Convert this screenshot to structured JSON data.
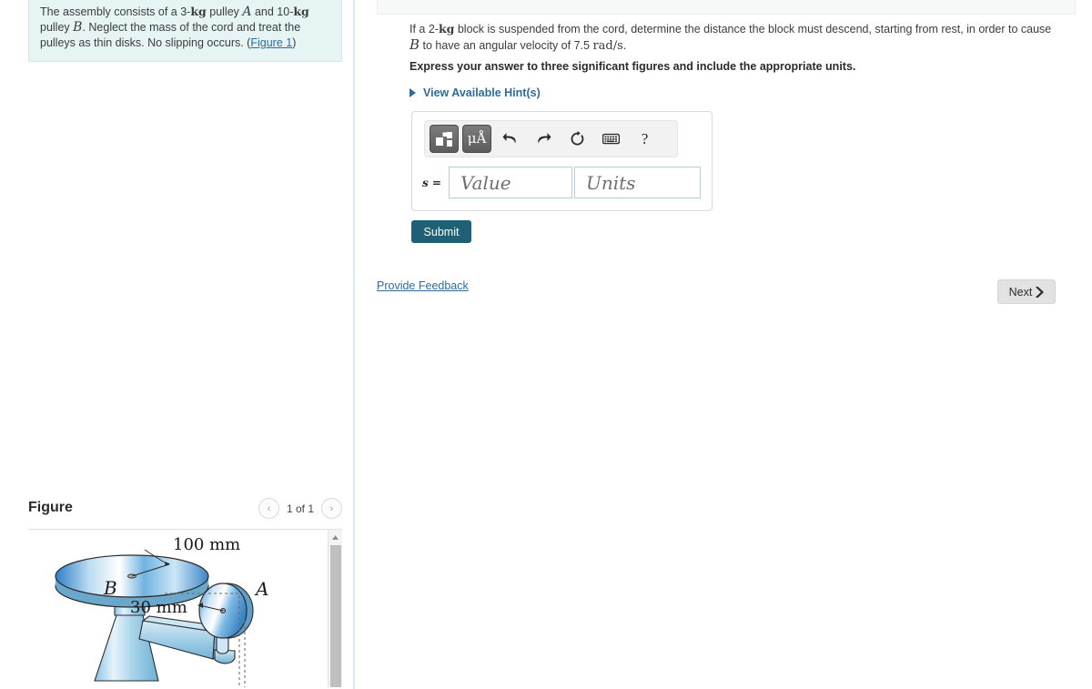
{
  "problem": {
    "text_part1": "The assembly consists of a 3-",
    "unit_kg_1": "kg",
    "text_part2": " pulley ",
    "pulley_a": "A",
    "text_part3": " and 10-",
    "unit_kg_2": "kg",
    "text_part4": "pulley ",
    "pulley_b": "B",
    "text_part5": ". Neglect the mass of the cord and treat the pulleys as thin disks. No slipping occurs. (",
    "figure_link": "Figure 1",
    "text_part6": ")"
  },
  "question": {
    "text_part1": "If a 2-",
    "unit_kg": "kg",
    "text_part2": " block is suspended from the cord, determine the distance the block must descend, starting from rest, in order to cause ",
    "body_b": "B",
    "text_part3": " to have an angular velocity of 7.5 ",
    "unit_rads": "rad/s",
    "text_part4": ".",
    "instruction": "Express your answer to three significant figures and include the appropriate units.",
    "hints_label": "View Available Hint(s)"
  },
  "answer": {
    "variable": "s =",
    "value_placeholder": "Value",
    "value": "",
    "units_placeholder": "Units",
    "units": "",
    "toolbar": {
      "template_icon": "math-template-icon",
      "units_icon_label": "μÅ",
      "undo_icon": "undo-icon",
      "redo_icon": "redo-icon",
      "reset_icon": "reset-icon",
      "keyboard_icon": "keyboard-icon",
      "help_icon": "?"
    }
  },
  "actions": {
    "submit_label": "Submit",
    "provide_feedback_label": "Provide Feedback",
    "next_label": "Next"
  },
  "figure": {
    "title": "Figure",
    "count_label": "1 of 1",
    "prev_icon": "‹",
    "next_icon": "›",
    "labels": {
      "dim_outer": "100 mm",
      "dim_inner": "30 mm",
      "pulley_b": "B",
      "pulley_a": "A"
    }
  },
  "colors": {
    "accent_link": "#2d6b9f",
    "submit_bg": "#1f6077",
    "problem_bg": "#e6f4f4",
    "next_bg": "#e2e2e2",
    "divider": "#dfe7ef"
  }
}
